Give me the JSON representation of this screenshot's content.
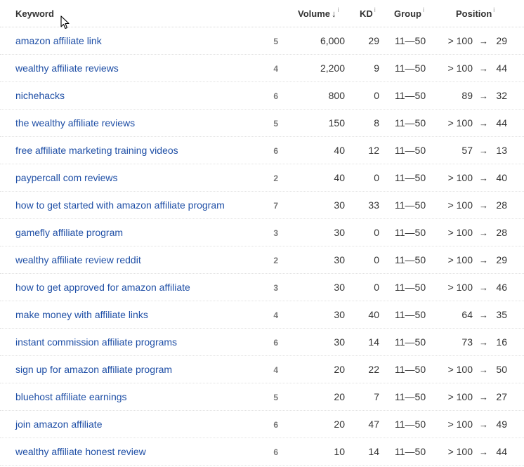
{
  "header": {
    "keyword": "Keyword",
    "volume": "Volume",
    "sort_arrow": "↓",
    "kd": "KD",
    "group": "Group",
    "position": "Position",
    "info_glyph": "i"
  },
  "pos_arrow_glyph": "→",
  "rows": [
    {
      "keyword": "amazon affiliate link",
      "words": "5",
      "volume": "6,000",
      "kd": "29",
      "group": "11—50",
      "from": "> 100",
      "to": "29"
    },
    {
      "keyword": "wealthy affiliate reviews",
      "words": "4",
      "volume": "2,200",
      "kd": "9",
      "group": "11—50",
      "from": "> 100",
      "to": "44"
    },
    {
      "keyword": "nichehacks",
      "words": "6",
      "volume": "800",
      "kd": "0",
      "group": "11—50",
      "from": "89",
      "to": "32"
    },
    {
      "keyword": "the wealthy affiliate reviews",
      "words": "5",
      "volume": "150",
      "kd": "8",
      "group": "11—50",
      "from": "> 100",
      "to": "44"
    },
    {
      "keyword": "free affiliate marketing training videos",
      "words": "6",
      "volume": "40",
      "kd": "12",
      "group": "11—50",
      "from": "57",
      "to": "13"
    },
    {
      "keyword": "paypercall com reviews",
      "words": "2",
      "volume": "40",
      "kd": "0",
      "group": "11—50",
      "from": "> 100",
      "to": "40"
    },
    {
      "keyword": "how to get started with amazon affiliate program",
      "words": "7",
      "volume": "30",
      "kd": "33",
      "group": "11—50",
      "from": "> 100",
      "to": "28"
    },
    {
      "keyword": "gamefly affiliate program",
      "words": "3",
      "volume": "30",
      "kd": "0",
      "group": "11—50",
      "from": "> 100",
      "to": "28"
    },
    {
      "keyword": "wealthy affiliate review reddit",
      "words": "2",
      "volume": "30",
      "kd": "0",
      "group": "11—50",
      "from": "> 100",
      "to": "29"
    },
    {
      "keyword": "how to get approved for amazon affiliate",
      "words": "3",
      "volume": "30",
      "kd": "0",
      "group": "11—50",
      "from": "> 100",
      "to": "46"
    },
    {
      "keyword": "make money with affiliate links",
      "words": "4",
      "volume": "30",
      "kd": "40",
      "group": "11—50",
      "from": "64",
      "to": "35"
    },
    {
      "keyword": "instant commission affiliate programs",
      "words": "6",
      "volume": "30",
      "kd": "14",
      "group": "11—50",
      "from": "73",
      "to": "16"
    },
    {
      "keyword": "sign up for amazon affiliate program",
      "words": "4",
      "volume": "20",
      "kd": "22",
      "group": "11—50",
      "from": "> 100",
      "to": "50"
    },
    {
      "keyword": "bluehost affiliate earnings",
      "words": "5",
      "volume": "20",
      "kd": "7",
      "group": "11—50",
      "from": "> 100",
      "to": "27"
    },
    {
      "keyword": "join amazon affiliate",
      "words": "6",
      "volume": "20",
      "kd": "47",
      "group": "11—50",
      "from": "> 100",
      "to": "49"
    },
    {
      "keyword": "wealthy affiliate honest review",
      "words": "6",
      "volume": "10",
      "kd": "14",
      "group": "11—50",
      "from": "> 100",
      "to": "44"
    }
  ]
}
